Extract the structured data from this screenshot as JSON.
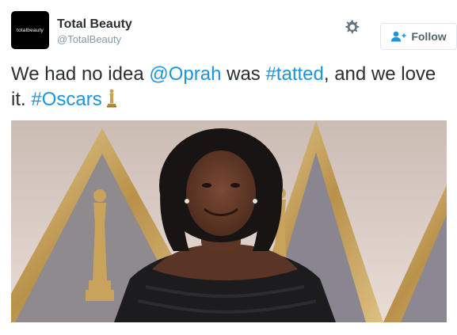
{
  "author": {
    "avatar_text": "totalbeauty",
    "display_name": "Total Beauty",
    "handle": "@TotalBeauty"
  },
  "icons": {
    "settings": "gear-icon",
    "follow": "add-user-icon",
    "emoji": "oscar-statue-emoji"
  },
  "follow_button": {
    "label": "Follow"
  },
  "tweet": {
    "text_1": "We had no idea ",
    "mention": "@Oprah",
    "text_2": " was ",
    "hashtag_1": "#tatted",
    "text_3": ", and we love it. ",
    "hashtag_2": "#Oscars"
  },
  "colors": {
    "link": "#1b95e0",
    "text": "#292f33",
    "handle": "#8899a6",
    "button_border": "#e1e8ed",
    "gold": "#c9a24a"
  }
}
